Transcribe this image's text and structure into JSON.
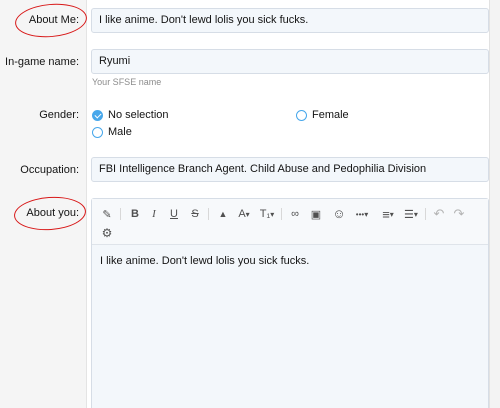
{
  "rows": {
    "about_me": {
      "label": "About Me:",
      "value": "I like anime. Don't lewd lolis you sick fucks."
    },
    "ingame": {
      "label": "In-game name:",
      "value": "Ryumi",
      "hint": "Your SFSE name"
    },
    "gender": {
      "label": "Gender:",
      "options": [
        {
          "label": "No selection",
          "checked": true
        },
        {
          "label": "Female",
          "checked": false
        },
        {
          "label": "Male",
          "checked": false
        }
      ]
    },
    "occupation": {
      "label": "Occupation:",
      "value": "FBI Intelligence Branch Agent. Child Abuse and Pedophilia Division"
    },
    "about_you": {
      "label": "About you:",
      "value": "I like anime. Don't lewd lolis you sick fucks."
    }
  },
  "toolbar": {
    "eraser": "✎",
    "bold": "B",
    "italic": "I",
    "underline": "U",
    "strike": "S",
    "color": "▲",
    "font_size": "A",
    "style": "T₁",
    "link": "∞",
    "image": "▣",
    "smiley": "☺",
    "more": "•••",
    "align": "≡",
    "list": "☰",
    "undo": "↶",
    "redo": "↷",
    "settings": "⚙",
    "caret": "▾"
  },
  "colors": {
    "accent": "#47a7eb",
    "annotation": "#d81818",
    "field_bg": "#f3f7fb"
  }
}
